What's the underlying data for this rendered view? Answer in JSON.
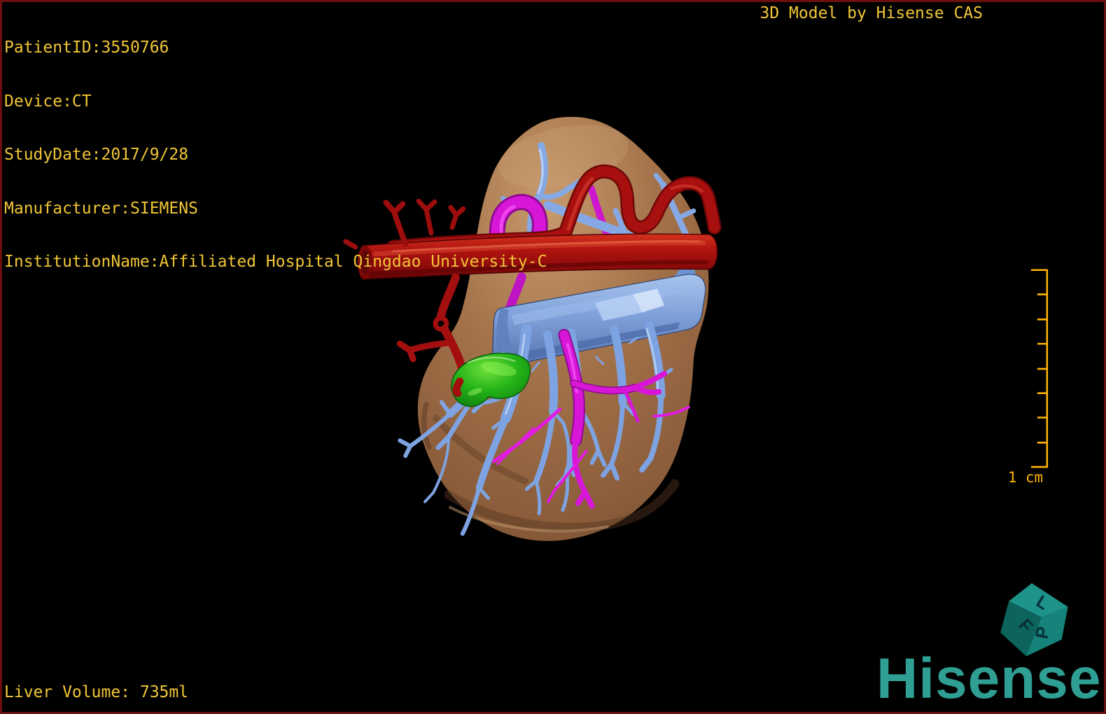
{
  "overlay": {
    "patient_lines": [
      "PatientID:3550766",
      "Device:CT",
      "StudyDate:2017/9/28",
      "Manufacturer:SIEMENS",
      "InstitutionName:Affiliated Hospital Qingdao University-C"
    ],
    "model_credit": "3D Model by Hisense CAS",
    "liver_volume": "Liver Volume: 735ml"
  },
  "scale_bar": {
    "label": "1 cm",
    "divisions": 8
  },
  "orientation_cube": {
    "top_letter": "L",
    "left_letter": "F",
    "right_letter": "P"
  },
  "branding": {
    "logo_text": "Hisense"
  },
  "structures": [
    {
      "name": "liver",
      "color": "#a3734b"
    },
    {
      "name": "hepatic-artery",
      "color": "#a81010"
    },
    {
      "name": "portal-vein",
      "color": "#7ea3e2"
    },
    {
      "name": "inferior-vena-cava",
      "color": "#7fa2dd"
    },
    {
      "name": "hepatic-vein",
      "color": "#d816d8"
    },
    {
      "name": "gallbladder",
      "color": "#17a517"
    }
  ],
  "colors": {
    "overlay_text": "#f1c636",
    "scale_bar": "#ffb405",
    "logo": "#2f9e93",
    "border": "#6b0f0f",
    "background": "#000000",
    "cube": "#16837b"
  }
}
